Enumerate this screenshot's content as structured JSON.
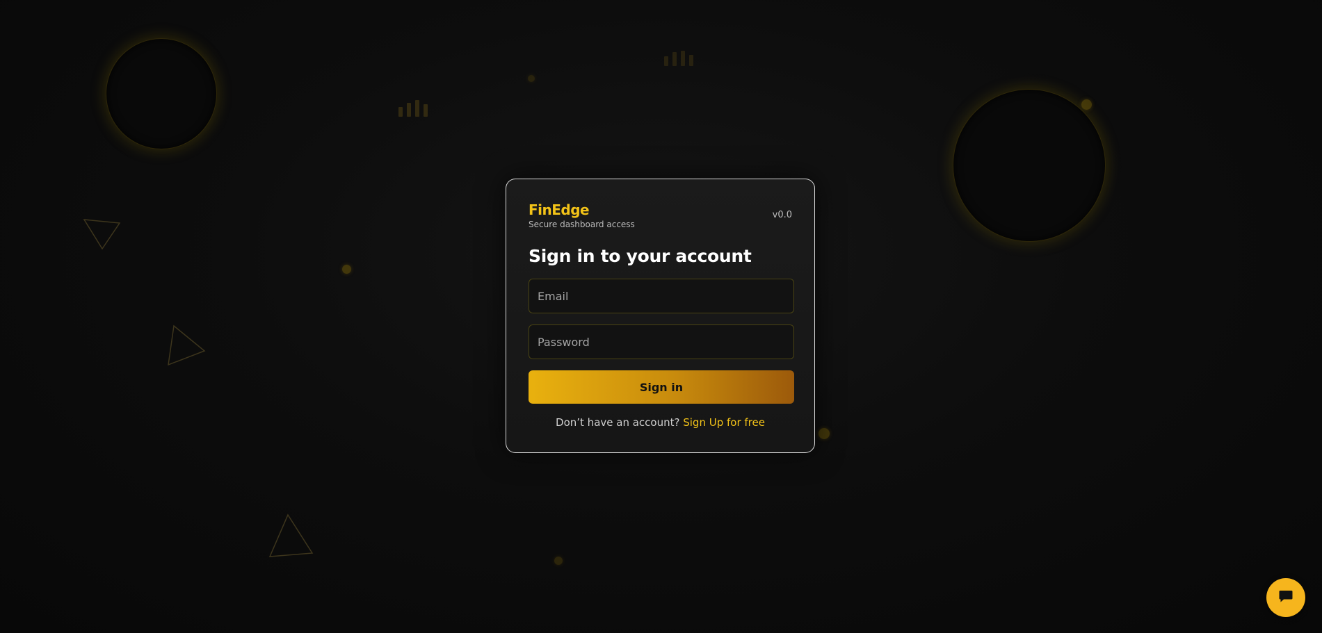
{
  "brand": {
    "name": "FinEdge",
    "tagline": "Secure dashboard access",
    "version": "v0.0"
  },
  "form": {
    "heading": "Sign in to your account",
    "email": {
      "placeholder": "Email",
      "value": ""
    },
    "password": {
      "placeholder": "Password",
      "value": ""
    },
    "submit_label": "Sign in",
    "signup_prompt": "Don’t have an account?",
    "signup_link": "Sign Up for free"
  },
  "chat": {
    "icon": "chat-bubble-icon"
  },
  "colors": {
    "accent": "#f3c318",
    "button_gradient_start": "#e9b10e",
    "button_gradient_end": "#9c5a0b",
    "background": "#0d0d0d",
    "chat_button": "#f6b51d"
  }
}
